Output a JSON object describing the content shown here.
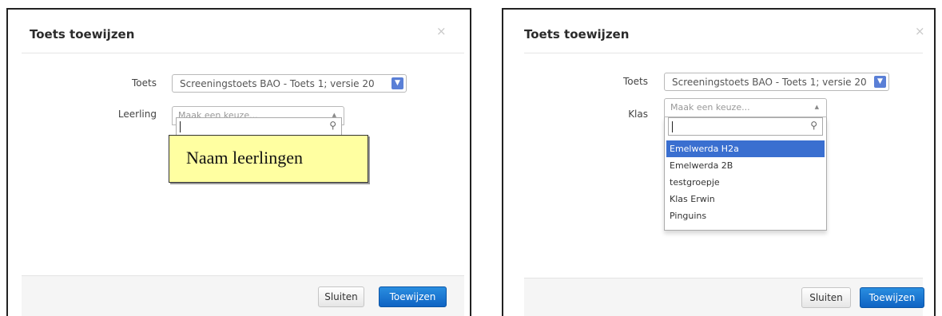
{
  "left_dialog": {
    "title": "Toets toewijzen",
    "close_label": "×",
    "test_label": "Toets",
    "test_value": "Screeningstoets BAO - Toets 1; versie 20",
    "student_label": "Leerling",
    "student_placeholder": "Maak een keuze...",
    "callout_text": "Naam leerlingen",
    "buttons": {
      "close": "Sluiten",
      "assign": "Toewijzen"
    }
  },
  "right_dialog": {
    "title": "Toets toewijzen",
    "close_label": "×",
    "test_label": "Toets",
    "test_value": "Screeningstoets BAO - Toets 1; versie 20",
    "class_label": "Klas",
    "class_placeholder": "Maak een keuze...",
    "class_options": [
      "Emelwerda H2a",
      "Emelwerda 2B",
      "testgroepje",
      "Klas Erwin",
      "Pinguins"
    ],
    "highlighted_option": "Emelwerda H2a",
    "buttons": {
      "close": "Sluiten",
      "assign": "Toewijzen"
    }
  },
  "icons": {
    "close": "close-icon",
    "select_arrow": "chevron-down-icon",
    "chosen_caret": "caret-up-icon",
    "search": "search-icon"
  },
  "colors": {
    "primary_button": "#1a73cf",
    "highlight": "#3a6fd0",
    "callout_background": "#ffffa1",
    "footer_background": "#f5f5f5"
  }
}
